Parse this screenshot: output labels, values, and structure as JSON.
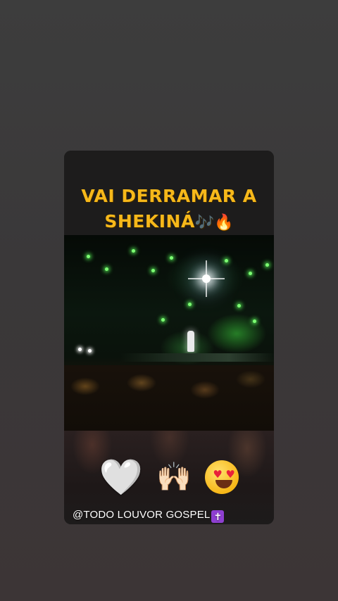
{
  "story": {
    "title_line_1": "VAI DERRAMAR A",
    "title_line_2": "SHEKINÁ",
    "title_emojis": "🎶🔥",
    "reaction_heart": "🤍",
    "reaction_hands": "🙌🏻",
    "reaction_face": "😍",
    "handle_text": "@TODO LOUVOR GOSPEL",
    "handle_badge": "✝",
    "colors": {
      "title": "#f6b81a",
      "background": "#3c3b3b",
      "card": "#1d1c1c",
      "badge": "#8e3fd1"
    },
    "icons": [
      "musical-notes-icon",
      "fire-icon",
      "white-heart-icon",
      "raising-hands-icon",
      "heart-eyes-face-icon",
      "latin-cross-icon"
    ]
  }
}
